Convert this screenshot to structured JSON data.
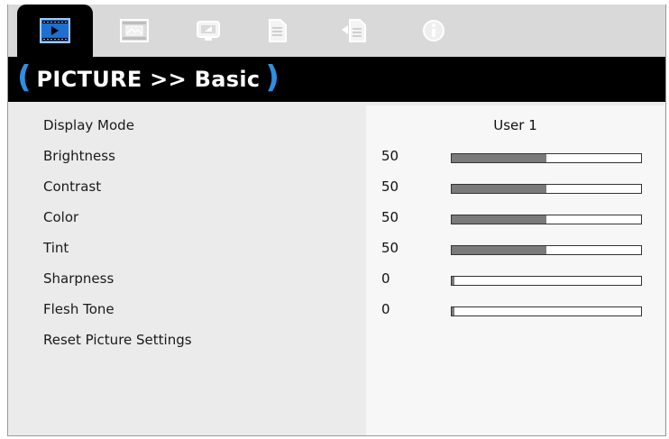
{
  "tabs": [
    {
      "name": "picture-tab-icon",
      "active": true
    },
    {
      "name": "image-tab-icon",
      "active": false
    },
    {
      "name": "display-tab-icon",
      "active": false
    },
    {
      "name": "setup-tab-icon",
      "active": false
    },
    {
      "name": "options-tab-icon",
      "active": false
    },
    {
      "name": "info-tab-icon",
      "active": false
    }
  ],
  "colors": {
    "accent_paren": "#2f8fe0",
    "bar_fill": "#7a7a7a"
  },
  "title": {
    "open": "(",
    "text": "PICTURE >> Basic",
    "close": ")"
  },
  "rows": [
    {
      "label": "Display Mode",
      "value": "User 1"
    },
    {
      "label": "Brightness",
      "value": "50",
      "level": 0.5
    },
    {
      "label": "Contrast",
      "value": "50",
      "level": 0.5
    },
    {
      "label": "Color",
      "value": "50",
      "level": 0.5
    },
    {
      "label": "Tint",
      "value": "50",
      "level": 0.5
    },
    {
      "label": "Sharpness",
      "value": "0",
      "level": 0.0
    },
    {
      "label": "Flesh Tone",
      "value": "0",
      "level": 0.0
    },
    {
      "label": "Reset Picture Settings"
    }
  ]
}
